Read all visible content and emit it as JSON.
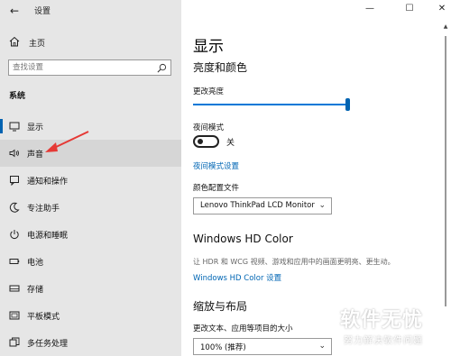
{
  "window": {
    "title": "设置",
    "back_icon": "←",
    "controls": {
      "minimize": "—",
      "maximize": "☐",
      "close": "✕"
    }
  },
  "sidebar": {
    "home_label": "主页",
    "search_placeholder": "查找设置",
    "section_label": "系统",
    "items": [
      {
        "label": "显示",
        "icon": "monitor-icon",
        "selected": true
      },
      {
        "label": "声音",
        "icon": "speaker-icon",
        "hover": true
      },
      {
        "label": "通知和操作",
        "icon": "notification-icon"
      },
      {
        "label": "专注助手",
        "icon": "moon-icon"
      },
      {
        "label": "电源和睡眠",
        "icon": "power-icon"
      },
      {
        "label": "电池",
        "icon": "battery-icon"
      },
      {
        "label": "存储",
        "icon": "storage-icon"
      },
      {
        "label": "平板模式",
        "icon": "tablet-icon"
      },
      {
        "label": "多任务处理",
        "icon": "multitask-icon"
      }
    ]
  },
  "main": {
    "title": "显示",
    "brightness": {
      "heading": "亮度和颜色",
      "label": "更改亮度",
      "value": 1.0
    },
    "night_light": {
      "label": "夜间模式",
      "state": "关",
      "settings_link": "夜间模式设置"
    },
    "color_profile": {
      "label": "颜色配置文件",
      "value": "Lenovo ThinkPad LCD Monitor"
    },
    "hd_color": {
      "heading": "Windows HD Color",
      "description": "让 HDR 和 WCG 视频、游戏和应用中的画面更明亮、更生动。",
      "link": "Windows HD Color 设置"
    },
    "scale_layout": {
      "heading": "缩放与布局",
      "label": "更改文本、应用等项目的大小",
      "value": "100% (推荐)"
    }
  },
  "watermark": {
    "main": "软件无忧",
    "sub": "努力解决软件问题"
  },
  "colors": {
    "accent": "#0078d7",
    "link": "#0066b4",
    "sidebar_bg": "#e6e6e6",
    "arrow": "#e53935"
  }
}
